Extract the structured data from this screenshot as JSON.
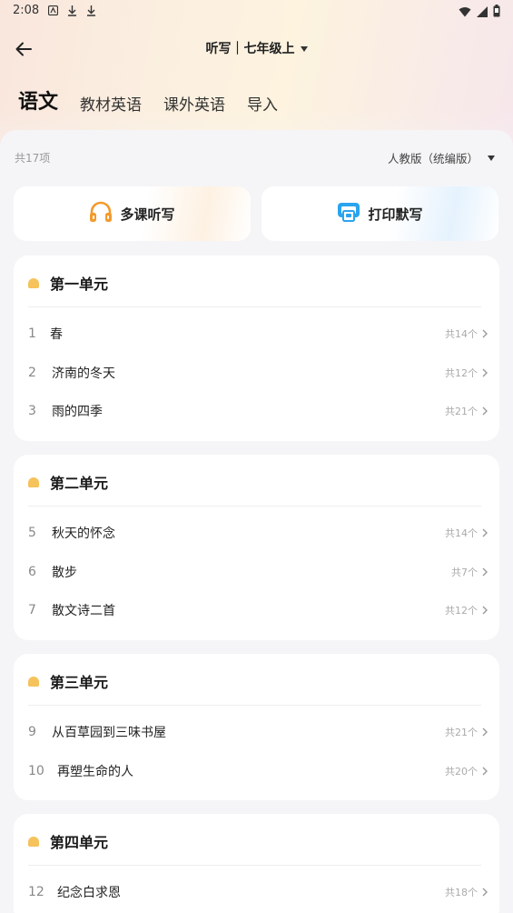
{
  "status_bar": {
    "time": "2:08"
  },
  "header": {
    "title": "听写｜七年级上"
  },
  "tabs": [
    {
      "label": "语文",
      "active": true
    },
    {
      "label": "教材英语",
      "active": false
    },
    {
      "label": "课外英语",
      "active": false
    },
    {
      "label": "导入",
      "active": false
    }
  ],
  "summary": {
    "count_text": "共17项",
    "edition": "人教版（统编版）"
  },
  "actions": {
    "multi_dictation": "多课听写",
    "print_dictation": "打印默写"
  },
  "units": [
    {
      "title": "第一单元",
      "lessons": [
        {
          "num": "1",
          "title": "春",
          "count": "共14个"
        },
        {
          "num": "2",
          "title": "济南的冬天",
          "count": "共12个"
        },
        {
          "num": "3",
          "title": "雨的四季",
          "count": "共21个"
        }
      ]
    },
    {
      "title": "第二单元",
      "lessons": [
        {
          "num": "5",
          "title": "秋天的怀念",
          "count": "共14个"
        },
        {
          "num": "6",
          "title": "散步",
          "count": "共7个"
        },
        {
          "num": "7",
          "title": "散文诗二首",
          "count": "共12个"
        }
      ]
    },
    {
      "title": "第三单元",
      "lessons": [
        {
          "num": "9",
          "title": "从百草园到三味书屋",
          "count": "共21个"
        },
        {
          "num": "10",
          "title": "再塑生命的人",
          "count": "共20个"
        }
      ]
    },
    {
      "title": "第四单元",
      "lessons": [
        {
          "num": "12",
          "title": "纪念白求恩",
          "count": "共18个"
        }
      ]
    }
  ],
  "colors": {
    "unit_dot": "#f6c25c",
    "headphone_orange": "#f39a2b",
    "print_blue": "#2aa4ee"
  }
}
